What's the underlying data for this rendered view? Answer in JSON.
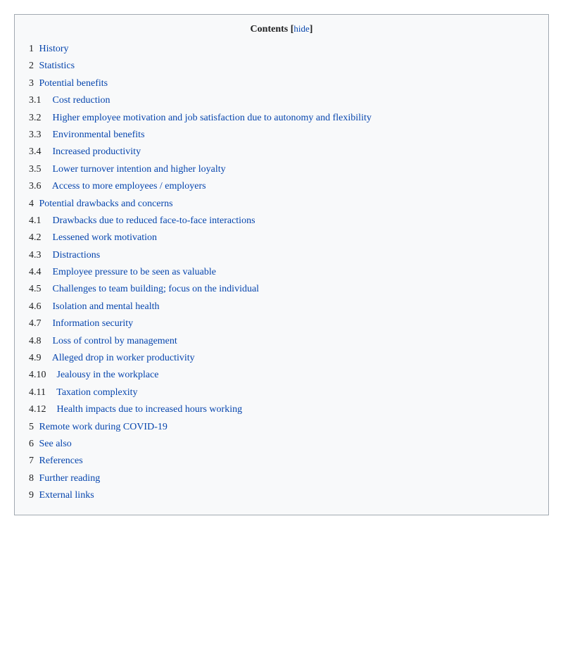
{
  "toc": {
    "title": "Contents",
    "hide_label": "[hide]",
    "top_items": [
      {
        "num": "1",
        "label": "History"
      },
      {
        "num": "2",
        "label": "Statistics"
      },
      {
        "num": "3",
        "label": "Potential benefits"
      },
      {
        "num": "4",
        "label": "Potential drawbacks and concerns"
      },
      {
        "num": "5",
        "label": "Remote work during COVID-19"
      },
      {
        "num": "6",
        "label": "See also"
      },
      {
        "num": "7",
        "label": "References"
      },
      {
        "num": "8",
        "label": "Further reading"
      },
      {
        "num": "9",
        "label": "External links"
      }
    ],
    "sub_items_3": [
      {
        "num": "3.1",
        "label": "Cost reduction"
      },
      {
        "num": "3.2",
        "label": "Higher employee motivation and job satisfaction due to autonomy and flexibility"
      },
      {
        "num": "3.3",
        "label": "Environmental benefits"
      },
      {
        "num": "3.4",
        "label": "Increased productivity"
      },
      {
        "num": "3.5",
        "label": "Lower turnover intention and higher loyalty"
      },
      {
        "num": "3.6",
        "label": "Access to more employees / employers"
      }
    ],
    "sub_items_4": [
      {
        "num": "4.1",
        "label": "Drawbacks due to reduced face-to-face interactions"
      },
      {
        "num": "4.2",
        "label": "Lessened work motivation"
      },
      {
        "num": "4.3",
        "label": "Distractions"
      },
      {
        "num": "4.4",
        "label": "Employee pressure to be seen as valuable"
      },
      {
        "num": "4.5",
        "label": "Challenges to team building; focus on the individual"
      },
      {
        "num": "4.6",
        "label": "Isolation and mental health"
      },
      {
        "num": "4.7",
        "label": "Information security"
      },
      {
        "num": "4.8",
        "label": "Loss of control by management"
      },
      {
        "num": "4.9",
        "label": "Alleged drop in worker productivity"
      },
      {
        "num": "4.10",
        "label": "Jealousy in the workplace"
      },
      {
        "num": "4.11",
        "label": "Taxation complexity"
      },
      {
        "num": "4.12",
        "label": "Health impacts due to increased hours working"
      }
    ]
  }
}
